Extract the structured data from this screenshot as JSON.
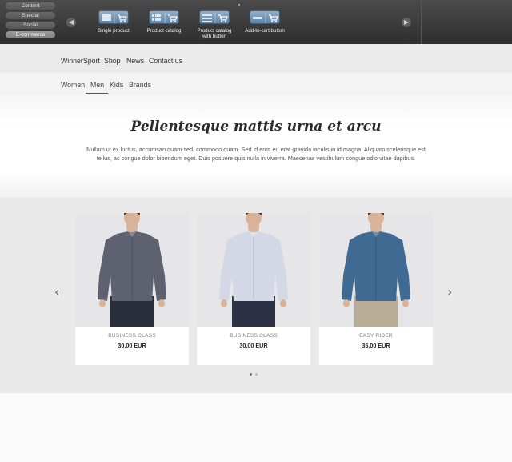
{
  "toolbar": {
    "categories": [
      "Content",
      "Special",
      "Social",
      "E-commerce"
    ],
    "widgets": [
      {
        "label": "Single product",
        "icon": "single-product-icon"
      },
      {
        "label": "Product catalog",
        "icon": "product-catalog-icon"
      },
      {
        "label": "Product catalog\nwith button",
        "icon": "product-catalog-button-icon"
      },
      {
        "label": "Add-to-cart button",
        "icon": "add-to-cart-icon"
      }
    ]
  },
  "nav": {
    "main": [
      "WinnerSport",
      "Shop",
      "News",
      "Contact us"
    ],
    "main_active": "Shop",
    "sub": [
      "Women",
      "Men",
      "Kids",
      "Brands"
    ],
    "sub_active": "Men"
  },
  "hero": {
    "title": "Pellentesque mattis urna et arcu",
    "body": "Nullam ut ex luctus, accumsan quam sed, commodo quam. Sed id eros eu erat gravida iaculis in id magna. Aliquam scelerisque est tellus, ac congue dolor bibendum eget. Duis posuere quis nulla in viverra. Maecenas vestibulum congue odio vitae dapibus."
  },
  "products": [
    {
      "name": "BUSINESS CLASS",
      "price": "30,00 EUR",
      "shirt_color": "#5d6170",
      "pants_color": "#2a2d3a"
    },
    {
      "name": "BUSINESS CLASS",
      "price": "30,00 EUR",
      "shirt_color": "#d4d8e6",
      "pants_color": "#2c3145"
    },
    {
      "name": "EASY RIDER",
      "price": "35,00 EUR",
      "shirt_color": "#3f6a92",
      "pants_color": "#b9ad97"
    }
  ],
  "carousel": {
    "prev": "‹",
    "next": "›"
  }
}
